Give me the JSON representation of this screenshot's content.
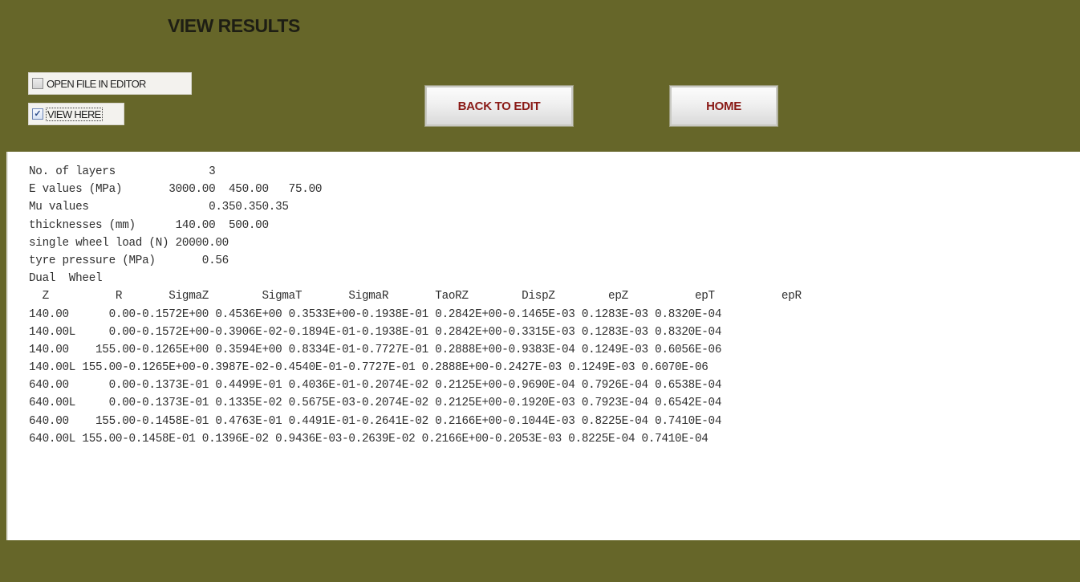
{
  "header": {
    "title": "VIEW RESULTS"
  },
  "options": {
    "open_file_in_editor": {
      "label": "OPEN FILE IN EDITOR",
      "checked": false
    },
    "view_here": {
      "label": "VIEW HERE",
      "checked": true,
      "check_glyph": "✓"
    }
  },
  "buttons": {
    "back_to_edit": "BACK TO EDIT",
    "home": "HOME"
  },
  "results": {
    "lines": [
      "No. of layers              3",
      "E values (MPa)       3000.00  450.00   75.00",
      "Mu values                  0.350.350.35",
      "thicknesses (mm)      140.00  500.00",
      "single wheel load (N) 20000.00",
      "tyre pressure (MPa)       0.56",
      "Dual  Wheel",
      "  Z          R       SigmaZ        SigmaT       SigmaR       TaoRZ        DispZ        epZ          epT          epR",
      "140.00      0.00-0.1572E+00 0.4536E+00 0.3533E+00-0.1938E-01 0.2842E+00-0.1465E-03 0.1283E-03 0.8320E-04",
      "140.00L     0.00-0.1572E+00-0.3906E-02-0.1894E-01-0.1938E-01 0.2842E+00-0.3315E-03 0.1283E-03 0.8320E-04",
      "140.00    155.00-0.1265E+00 0.3594E+00 0.8334E-01-0.7727E-01 0.2888E+00-0.9383E-04 0.1249E-03 0.6056E-06",
      "140.00L 155.00-0.1265E+00-0.3987E-02-0.4540E-01-0.7727E-01 0.2888E+00-0.2427E-03 0.1249E-03 0.6070E-06",
      "640.00      0.00-0.1373E-01 0.4499E-01 0.4036E-01-0.2074E-02 0.2125E+00-0.9690E-04 0.7926E-04 0.6538E-04",
      "640.00L     0.00-0.1373E-01 0.1335E-02 0.5675E-03-0.2074E-02 0.2125E+00-0.1920E-03 0.7923E-04 0.6542E-04",
      "640.00    155.00-0.1458E-01 0.4763E-01 0.4491E-01-0.2641E-02 0.2166E+00-0.1044E-03 0.8225E-04 0.7410E-04",
      "640.00L 155.00-0.1458E-01 0.1396E-02 0.9436E-03-0.2639E-02 0.2166E+00-0.2053E-03 0.8225E-04 0.7410E-04"
    ]
  },
  "colors": {
    "background": "#666629",
    "title_text": "#1e1e14",
    "button_text": "#8a1a16",
    "panel": "#ffffff"
  }
}
